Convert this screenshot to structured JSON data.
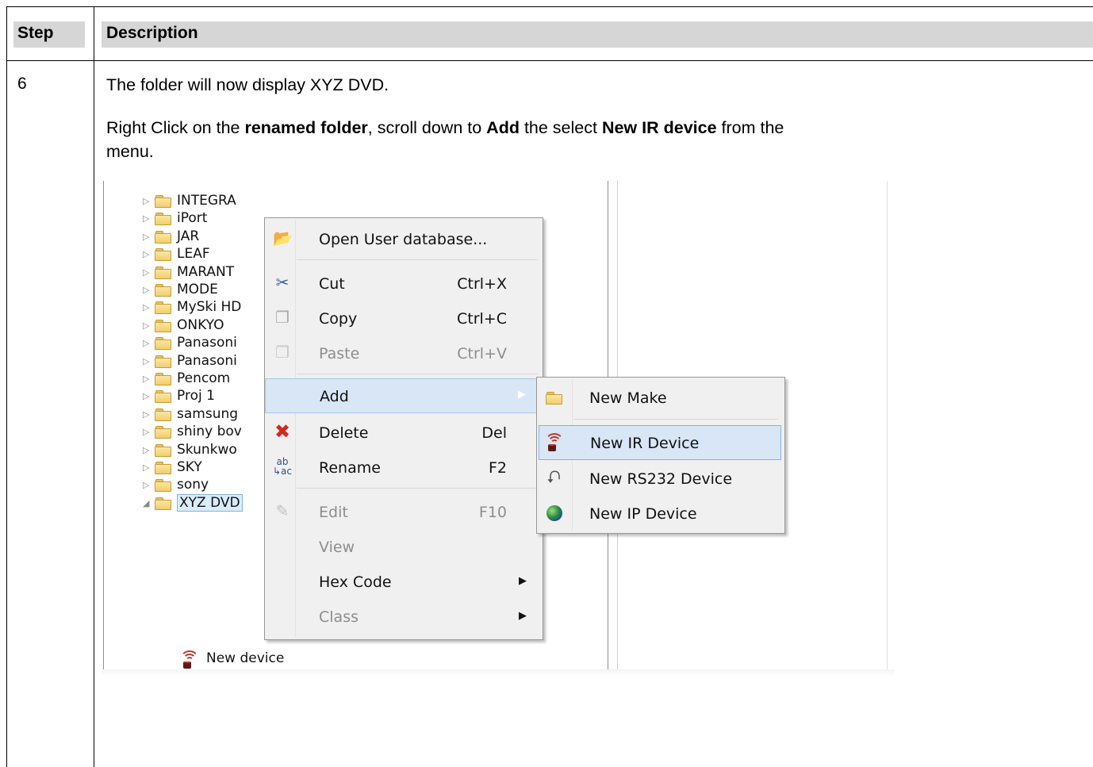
{
  "table": {
    "header_step": "Step",
    "header_description": "Description",
    "step_number": "6",
    "para1": "The folder will now display XYZ DVD.",
    "para2": {
      "t1": "Right Click on the ",
      "b1": "renamed folder",
      "t2": ", scroll down to ",
      "b2": "Add",
      "t3": " the select ",
      "b3": "New IR device",
      "t4": " from the",
      "line2": "menu."
    }
  },
  "tree": {
    "items": [
      {
        "label": "INTEGRA"
      },
      {
        "label": "iPort"
      },
      {
        "label": "JAR"
      },
      {
        "label": "LEAF"
      },
      {
        "label": "MARANT"
      },
      {
        "label": "MODE"
      },
      {
        "label": "MySki HD"
      },
      {
        "label": "ONKYO"
      },
      {
        "label": "Panasoni"
      },
      {
        "label": "Panasoni"
      },
      {
        "label": "Pencom"
      },
      {
        "label": "Proj 1"
      },
      {
        "label": "samsung"
      },
      {
        "label": "shiny bov"
      },
      {
        "label": "Skunkwo"
      },
      {
        "label": "SKY"
      },
      {
        "label": "sony"
      },
      {
        "label": "XYZ DVD"
      }
    ],
    "child_label": "New device"
  },
  "context_menu": {
    "open_db": "Open User database...",
    "cut": "Cut",
    "cut_sc": "Ctrl+X",
    "copy": "Copy",
    "copy_sc": "Ctrl+C",
    "paste": "Paste",
    "paste_sc": "Ctrl+V",
    "add": "Add",
    "delete": "Delete",
    "delete_sc": "Del",
    "rename": "Rename",
    "rename_sc": "F2",
    "edit": "Edit",
    "edit_sc": "F10",
    "view": "View",
    "hex_code": "Hex Code",
    "class": "Class"
  },
  "submenu": {
    "new_make": "New Make",
    "new_ir": "New IR Device",
    "new_rs232": "New RS232 Device",
    "new_ip": "New IP Device"
  },
  "icons": {
    "folder": "folder-icon",
    "ir": "infrared-signal-icon",
    "rs232": "serial-cable-icon",
    "ip": "globe-icon"
  },
  "colors": {
    "header_fill": "#d6d6d6",
    "highlight": "#d8e6f5",
    "selection_border": "#7fb4e0"
  }
}
